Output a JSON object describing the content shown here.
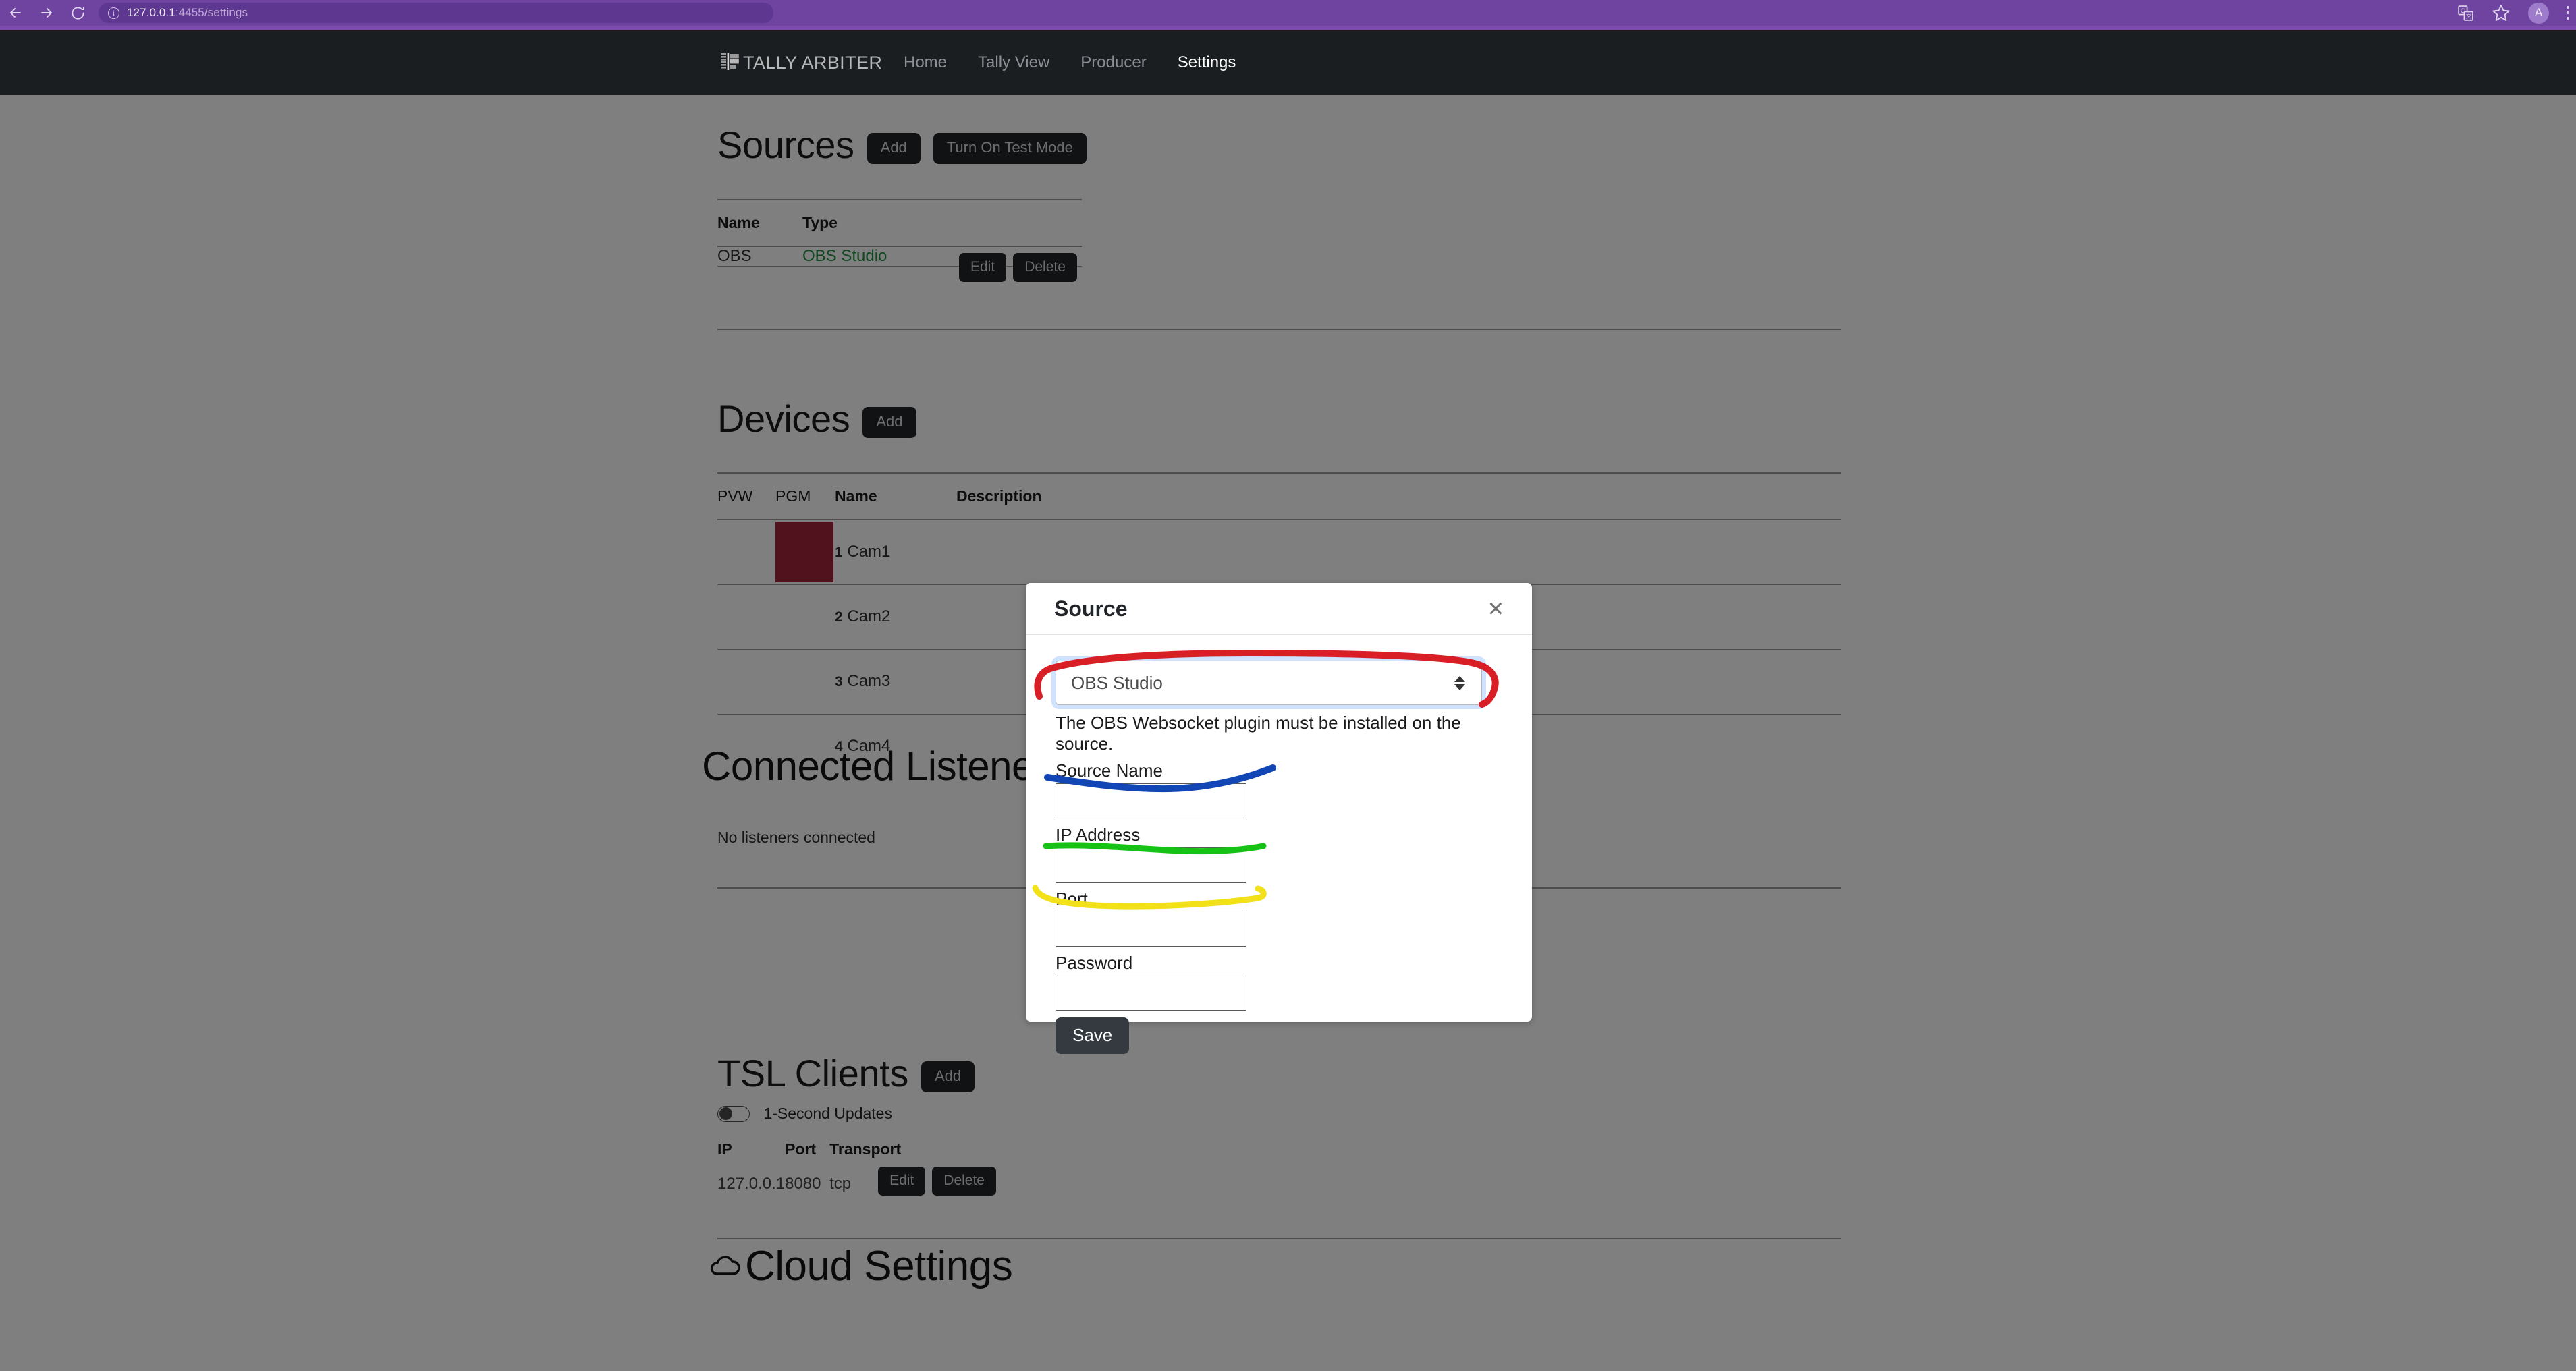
{
  "browser": {
    "back_icon": "back-arrow-icon",
    "forward_icon": "forward-arrow-icon",
    "reload_icon": "reload-icon",
    "site_info_icon": "site-info-icon",
    "url_host": "127.0.0.1",
    "url_rest": ":4455/settings",
    "url_full": "127.0.0.1:4455/settings",
    "translate_icon": "translate-icon",
    "bookmark_icon": "star-icon",
    "avatar_initial": "A",
    "menu_icon": "kebab-menu-icon",
    "chrome_color": "#6e44a0"
  },
  "app": {
    "brand": "TALLY ARBITER",
    "brand_icon": "tally-bars-icon",
    "navbar_color": "#1a1e21",
    "nav": [
      {
        "label": "Home",
        "active": false
      },
      {
        "label": "Tally View",
        "active": false
      },
      {
        "label": "Producer",
        "active": false
      },
      {
        "label": "Settings",
        "active": true
      }
    ]
  },
  "sources": {
    "heading": "Sources",
    "add_label": "Add",
    "test_mode_label": "Turn On Test Mode",
    "columns": [
      "Name",
      "Type"
    ],
    "rows": [
      {
        "name": "OBS",
        "type": "OBS Studio",
        "edit_label": "Edit",
        "delete_label": "Delete",
        "text_color": "#1e8f3e"
      }
    ]
  },
  "devices": {
    "heading": "Devices",
    "add_label": "Add",
    "columns": [
      "PVW",
      "PGM",
      "Name",
      "Description"
    ],
    "rows": [
      {
        "number": "1",
        "name": "Cam1",
        "description": "",
        "pgm": true,
        "pvw": false,
        "pgm_color": "#a2223a"
      },
      {
        "number": "2",
        "name": "Cam2",
        "description": "",
        "pgm": false,
        "pvw": false
      },
      {
        "number": "3",
        "name": "Cam3",
        "description": "",
        "pgm": false,
        "pvw": false
      },
      {
        "number": "4",
        "name": "Cam4",
        "description": "",
        "pgm": false,
        "pvw": false
      }
    ]
  },
  "listeners": {
    "heading": "Connected Listeners",
    "empty_text": "No listeners connected"
  },
  "tsl": {
    "heading": "TSL Clients",
    "add_label": "Add",
    "toggle_label": "1-Second Updates",
    "toggle_on": false,
    "columns": [
      "IP",
      "Port",
      "Transport"
    ],
    "rows": [
      {
        "ip": "127.0.0.1",
        "port": "8080",
        "transport": "tcp",
        "edit_label": "Edit",
        "delete_label": "Delete"
      }
    ]
  },
  "cloud": {
    "heading": "Cloud Settings",
    "icon": "cloud-icon"
  },
  "modal": {
    "title": "Source",
    "close_icon": "close-icon",
    "type_value": "OBS Studio",
    "type_options": [
      "OBS Studio"
    ],
    "help_text": "The OBS Websocket plugin must be installed on the source.",
    "fields": [
      {
        "label": "Source Name",
        "value": "",
        "placeholder": "",
        "type": "text"
      },
      {
        "label": "IP Address",
        "value": "",
        "placeholder": "",
        "type": "text"
      },
      {
        "label": "Port",
        "value": "",
        "placeholder": "",
        "type": "text"
      },
      {
        "label": "Password",
        "value": "",
        "placeholder": "",
        "type": "password"
      }
    ],
    "save_label": "Save",
    "annotations": [
      {
        "color": "#d81f26",
        "target": "type-select",
        "shape": "circle-around"
      },
      {
        "color": "#1146b4",
        "target": "source-name",
        "shape": "underline"
      },
      {
        "color": "#16c216",
        "target": "ip-address",
        "shape": "underline"
      },
      {
        "color": "#f2e118",
        "target": "port",
        "shape": "underline"
      }
    ]
  }
}
